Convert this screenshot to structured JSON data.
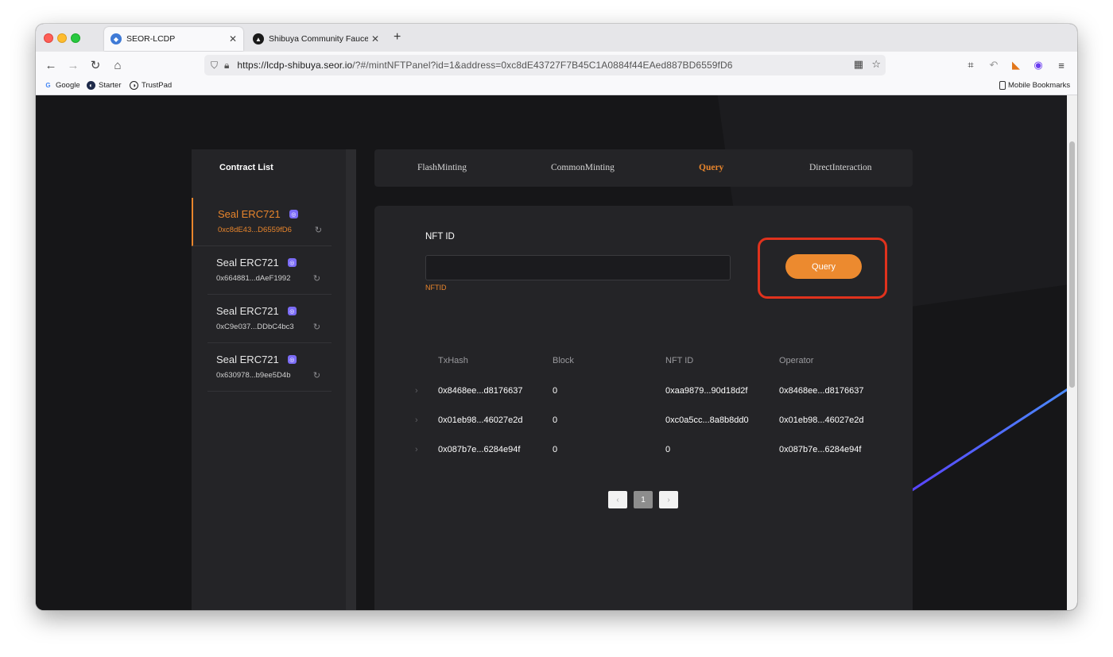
{
  "browser": {
    "tabs": [
      {
        "title": "SEOR-LCDP",
        "icon": "seor-logo-icon"
      },
      {
        "title": "Shibuya Community Faucet",
        "icon": "astar-logo-icon"
      }
    ],
    "url": {
      "host": "https://lcdp-shibuya.seor.io",
      "path": "/?#/mintNFTPanel?id=1&address=0xc8dE43727F7B45C1A0884f44EAed887BD6559fD6"
    },
    "bookmarks": [
      "Google",
      "Starter",
      "TrustPad"
    ],
    "mobile_bookmarks": "Mobile Bookmarks"
  },
  "sidebar": {
    "title": "Contract List",
    "items": [
      {
        "name": "Seal ERC721",
        "address": "0xc8dE43...D6559fD6",
        "active": true
      },
      {
        "name": "Seal ERC721",
        "address": "0x664881...dAeF1992",
        "active": false
      },
      {
        "name": "Seal ERC721",
        "address": "0xC9e037...DDbC4bc3",
        "active": false
      },
      {
        "name": "Seal ERC721",
        "address": "0x630978...b9ee5D4b",
        "active": false
      }
    ]
  },
  "panel_tabs": [
    "FlashMinting",
    "CommonMinting",
    "Query",
    "DirectInteraction"
  ],
  "active_tab": "Query",
  "query": {
    "label": "NFT ID",
    "value": "",
    "placeholder": "",
    "hint": "NFTID",
    "button": "Query"
  },
  "table": {
    "headers": [
      "TxHash",
      "Block",
      "NFT ID",
      "Operator"
    ],
    "rows": [
      [
        "0x8468ee...d8176637",
        "0",
        "0xaa9879...90d18d2f",
        "0x8468ee...d8176637"
      ],
      [
        "0x01eb98...46027e2d",
        "0",
        "0xc0a5cc...8a8b8dd0",
        "0x01eb98...46027e2d"
      ],
      [
        "0x087b7e...6284e94f",
        "0",
        "0",
        "0x087b7e...6284e94f"
      ]
    ]
  },
  "pagination": {
    "current": "1",
    "prev": "‹",
    "next": "›"
  },
  "colors": {
    "accent": "#e8852c",
    "highlight": "#e0321d",
    "background": "#161618",
    "panel": "#242427"
  }
}
